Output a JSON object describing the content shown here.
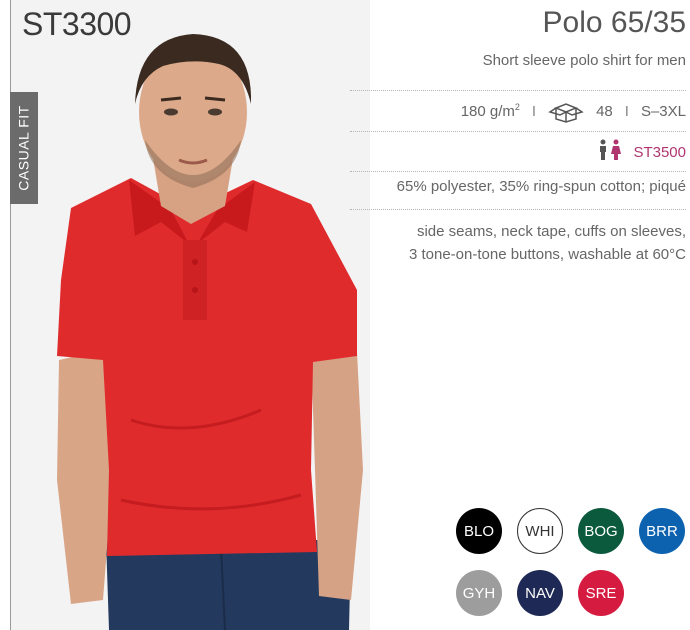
{
  "product": {
    "sku": "ST3300",
    "fit": "CASUAL FIT",
    "name": "Polo 65/35",
    "subtitle": "Short sleeve polo shirt for men",
    "weight": "180 g/m",
    "weight_sup": "2",
    "separator": "I",
    "pack_count": "48",
    "sizes": "S–3XL",
    "womens_code": "ST3500",
    "material": "65% polyester, 35% ring-spun cotton; piqué",
    "features_line1": "side seams, neck tape, cuffs on sleeves,",
    "features_line2": "3 tone-on-tone buttons, washable at 60°C"
  },
  "icons": {
    "pack": "box-icon",
    "womens": "man-woman-icon"
  },
  "colors": {
    "shirt": "#e02b2d",
    "womens_code": "#b0356f",
    "swatches": [
      {
        "code": "BLO",
        "color": "#000000",
        "text": "#ffffff"
      },
      {
        "code": "WHI",
        "color": "#ffffff",
        "text": "#333333"
      },
      {
        "code": "BOG",
        "color": "#0b5a3e",
        "text": "#ffffff"
      },
      {
        "code": "BRR",
        "color": "#0d62b0",
        "text": "#ffffff"
      },
      {
        "code": "GYH",
        "color": "#9d9d9d",
        "text": "#ffffff"
      },
      {
        "code": "NAV",
        "color": "#1e2a55",
        "text": "#ffffff"
      },
      {
        "code": "SRE",
        "color": "#d61b40",
        "text": "#ffffff"
      }
    ]
  }
}
